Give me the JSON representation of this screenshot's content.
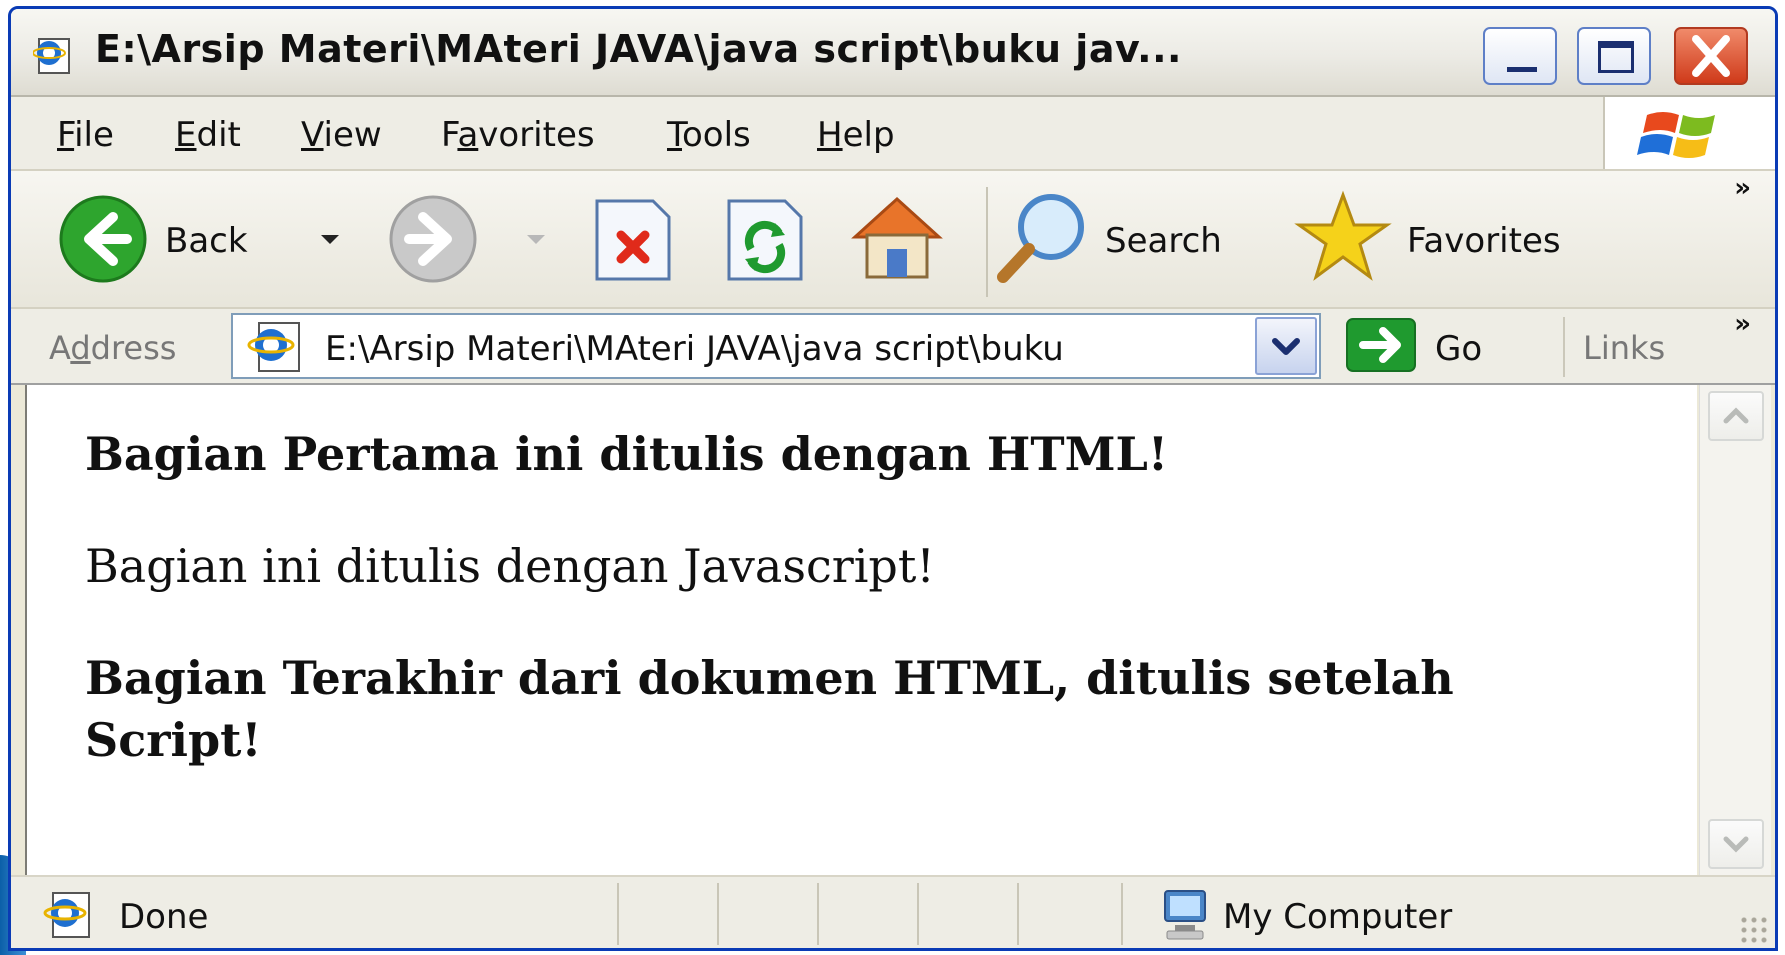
{
  "window": {
    "title": "E:\\Arsip Materi\\MAteri JAVA\\java script\\buku jav..."
  },
  "menubar": {
    "items": [
      {
        "rest": "ile",
        "key": "F"
      },
      {
        "rest": "dit",
        "key": "E"
      },
      {
        "rest": "iew",
        "key": "V"
      },
      {
        "pre": "F",
        "key": "a",
        "rest": "vorites"
      },
      {
        "rest": "ools",
        "key": "T"
      },
      {
        "rest": "elp",
        "key": "H"
      }
    ]
  },
  "toolbar": {
    "back_label": "Back",
    "search_label": "Search",
    "favorites_label": "Favorites",
    "overflow_label": "»"
  },
  "address": {
    "label_pre": "A",
    "label_key": "d",
    "label_rest": "dress",
    "value": "E:\\Arsip Materi\\MAteri JAVA\\java script\\buku",
    "go_label": "Go",
    "links_label": "Links",
    "overflow_label": "»"
  },
  "document": {
    "p1": "Bagian Pertama ini ditulis dengan HTML!",
    "p2": "Bagian ini ditulis dengan Javascript!",
    "p3": "Bagian Terakhir dari dokumen HTML, ditulis setelah Script!"
  },
  "status": {
    "text": "Done",
    "zone": "My Computer"
  },
  "colors": {
    "title_close": "#cf3a1a",
    "back_green": "#2ea52e",
    "go_green": "#1f9a2f",
    "star_yellow": "#f5d21a"
  }
}
